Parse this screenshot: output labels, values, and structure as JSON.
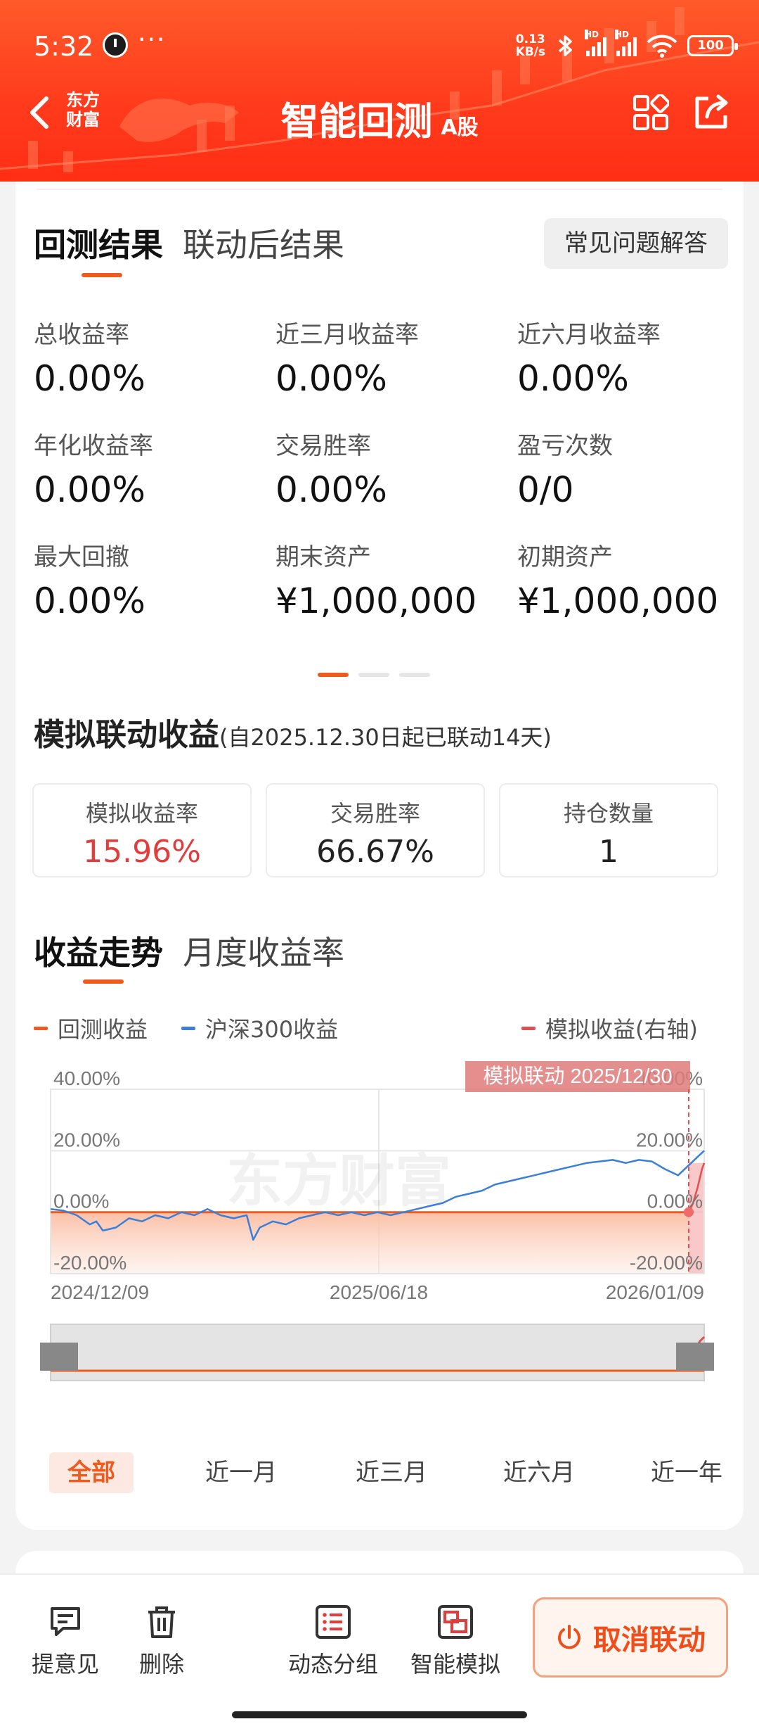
{
  "status_bar": {
    "time": "5:32",
    "dots": "···",
    "net_speed_value": "0.13",
    "net_speed_unit": "KB/s",
    "hd1": "HD",
    "hd2": "HD",
    "battery": "100"
  },
  "header": {
    "logo_line1": "东方",
    "logo_line2": "财富",
    "title": "智能回测",
    "title_sub": "A股"
  },
  "tabs_result": [
    {
      "label": "回测结果",
      "active": true
    },
    {
      "label": "联动后结果",
      "active": false
    }
  ],
  "faq_label": "常见问题解答",
  "metrics": [
    {
      "label": "总收益率",
      "value": "0.00%"
    },
    {
      "label": "近三月收益率",
      "value": "0.00%"
    },
    {
      "label": "近六月收益率",
      "value": "0.00%"
    },
    {
      "label": "年化收益率",
      "value": "0.00%"
    },
    {
      "label": "交易胜率",
      "value": "0.00%"
    },
    {
      "label": "盈亏次数",
      "value": "0/0"
    },
    {
      "label": "最大回撤",
      "value": "0.00%"
    },
    {
      "label": "期末资产",
      "value": "¥1,000,000"
    },
    {
      "label": "初期资产",
      "value": "¥1,000,000"
    }
  ],
  "sim": {
    "title": "模拟联动收益",
    "note": "(自2025.12.30日起已联动14天)",
    "boxes": [
      {
        "label": "模拟收益率",
        "value": "15.96%",
        "color": "#e23c3c"
      },
      {
        "label": "交易胜率",
        "value": "66.67%"
      },
      {
        "label": "持仓数量",
        "value": "1"
      }
    ]
  },
  "tabs_trend": [
    {
      "label": "收益走势",
      "active": true
    },
    {
      "label": "月度收益率",
      "active": false
    }
  ],
  "legend": [
    {
      "label": "回测收益",
      "color": "#ef5a1e"
    },
    {
      "label": "沪深300收益",
      "color": "#3b7fd9"
    },
    {
      "label": "模拟收益(右轴)",
      "color": "#e05050"
    }
  ],
  "chart_data": {
    "type": "line",
    "annotation": "模拟联动 2025/12/30",
    "watermark": "东方财富",
    "x_ticks": [
      "2024/12/09",
      "2025/06/18",
      "2026/01/09"
    ],
    "y_left_ticks": [
      "40.00%",
      "20.00%",
      "0.00%",
      "-20.00%"
    ],
    "y_right_ticks": [
      "40.00%",
      "20.00%",
      "0.00%",
      "-20.00%"
    ],
    "ylim": [
      -20,
      40
    ],
    "series": [
      {
        "name": "回测收益",
        "color": "#ef5a1e",
        "x": [
          0,
          1
        ],
        "values": [
          0,
          0
        ]
      },
      {
        "name": "沪深300收益",
        "color": "#3b7fd9",
        "x": [
          0,
          0.02,
          0.04,
          0.06,
          0.07,
          0.08,
          0.1,
          0.12,
          0.14,
          0.16,
          0.18,
          0.2,
          0.22,
          0.24,
          0.26,
          0.28,
          0.3,
          0.31,
          0.32,
          0.34,
          0.36,
          0.38,
          0.4,
          0.42,
          0.44,
          0.46,
          0.48,
          0.5,
          0.52,
          0.54,
          0.56,
          0.58,
          0.6,
          0.62,
          0.64,
          0.66,
          0.68,
          0.7,
          0.72,
          0.74,
          0.76,
          0.78,
          0.8,
          0.82,
          0.84,
          0.86,
          0.88,
          0.9,
          0.92,
          0.94,
          0.96,
          0.98,
          1
        ],
        "values": [
          1,
          0.5,
          -1,
          -4,
          -3,
          -6,
          -5,
          -2,
          -3,
          -1,
          -2,
          0,
          -1,
          1,
          -1,
          -2,
          -1,
          -9,
          -5,
          -3,
          -4,
          -2,
          -1,
          0,
          -1,
          0,
          -1,
          0,
          -1,
          0,
          1,
          2,
          3,
          5,
          6,
          7,
          9,
          10,
          11,
          12,
          13,
          14,
          15,
          16,
          16.5,
          17,
          16,
          17,
          16.5,
          14,
          12,
          16,
          20
        ]
      },
      {
        "name": "模拟收益(右轴)",
        "color": "#e05050",
        "x": [
          0.965,
          0.975,
          0.985,
          0.995,
          1
        ],
        "values": [
          0,
          3,
          8,
          14,
          16
        ]
      }
    ],
    "brush_ticks": [
      "",
      ""
    ]
  },
  "ranges": [
    {
      "label": "全部",
      "active": true
    },
    {
      "label": "近一月",
      "active": false
    },
    {
      "label": "近三月",
      "active": false
    },
    {
      "label": "近六月",
      "active": false
    },
    {
      "label": "近一年",
      "active": false
    }
  ],
  "bottom_bar": {
    "feedback": "提意见",
    "delete": "删除",
    "group": "动态分组",
    "simulate": "智能模拟",
    "cancel": "取消联动"
  }
}
